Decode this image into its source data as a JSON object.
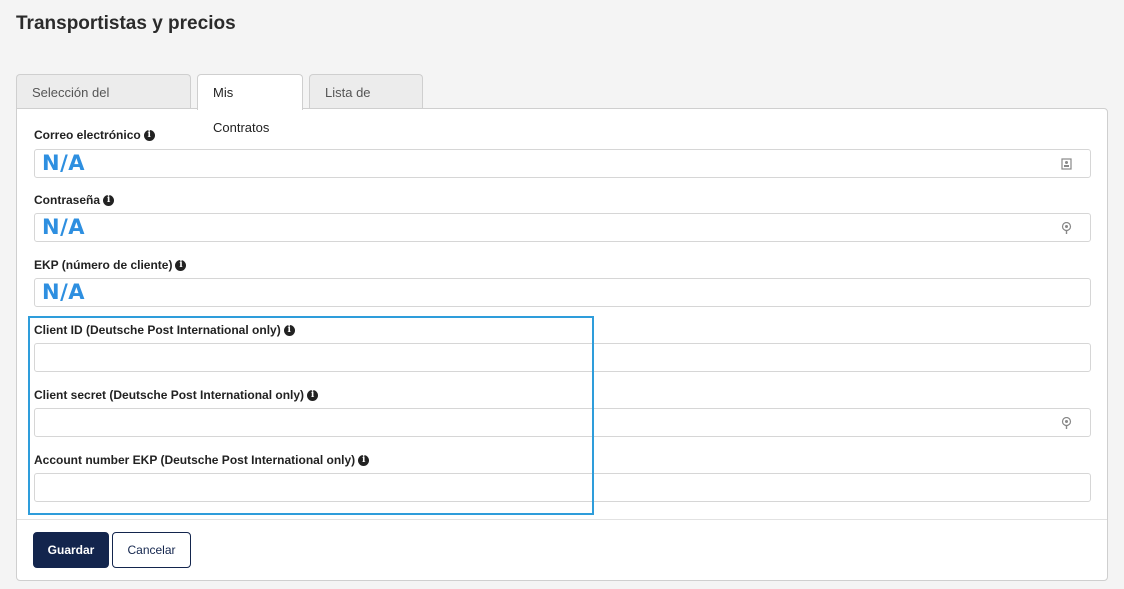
{
  "page": {
    "title": "Transportistas y precios"
  },
  "tabs": [
    {
      "label": "Selección del transportista",
      "active": false
    },
    {
      "label": "Mis Contratos",
      "active": true
    },
    {
      "label": "Lista de precios",
      "active": false
    }
  ],
  "form": {
    "email": {
      "label": "Correo electrónico",
      "value": "N/A",
      "icon": "contact-card-icon"
    },
    "password": {
      "label": "Contraseña",
      "value": "N/A",
      "icon": "key-icon"
    },
    "ekp": {
      "label": "EKP (número de cliente)",
      "value": "N/A"
    },
    "client_id": {
      "label": "Client ID (Deutsche Post International only)",
      "value": ""
    },
    "client_secret": {
      "label": "Client secret (Deutsche Post International only)",
      "value": "",
      "icon": "key-icon"
    },
    "account_number": {
      "label": "Account number EKP (Deutsche Post International only)",
      "value": ""
    }
  },
  "info_glyph": "i",
  "buttons": {
    "save": "Guardar",
    "cancel": "Cancelar"
  },
  "colors": {
    "accent": "#2e8fe0",
    "highlight": "#2e9ddb",
    "primary": "#13254d"
  }
}
